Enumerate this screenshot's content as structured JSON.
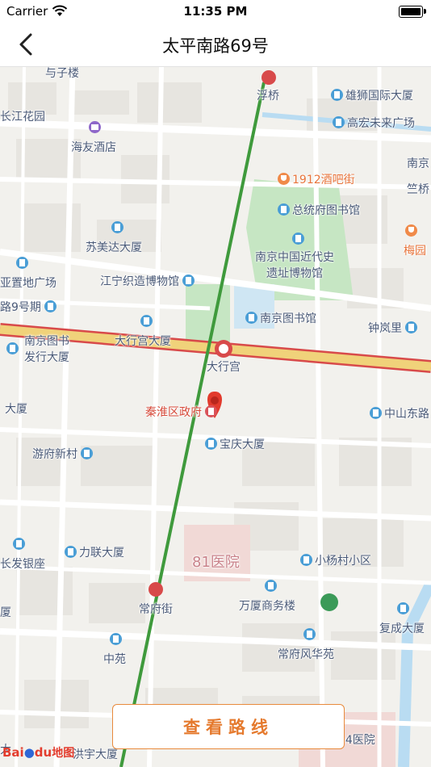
{
  "status": {
    "carrier": "Carrier",
    "time": "11:35 PM"
  },
  "nav": {
    "title": "太平南路69号"
  },
  "map": {
    "labels": {
      "yuzilou": "与子楼",
      "fuqiao": "浮桥",
      "xiongshi": "雄狮国际大厦",
      "changjiang": "长江花园",
      "gaohong": "高宏未来广场",
      "haiyou": "海友酒店",
      "nanjing_edge": "南京",
      "bar1912": "1912酒吧街",
      "zhuyuan": "竺桥",
      "zongtongfu": "总统府图书馆",
      "sumeida": "苏美达大厦",
      "museum_line1": "南京中国近代史",
      "museum_line2": "遗址博物馆",
      "meiyuan": "梅园",
      "yazhidi": "亚置地广场",
      "jiangning": "江宁织造博物馆",
      "lu9hao": "路9号期",
      "library": "南京图书馆",
      "zhonglanli": "钟岚里",
      "nanjingtushu1": "南京图书",
      "nanjingtushu2": "发行大厦",
      "daxinggong_tower": "大行宫大厦",
      "daxinggong_station": "大行宫",
      "qinhuai": "秦淮区政府",
      "zhongshan_east": "中山东路",
      "dasha_left": "大厦",
      "baoqing": "宝庆大厦",
      "youfu": "游府新村",
      "hospital81": "81医院",
      "changfa": "长发银座",
      "lilian": "力联大厦",
      "xiaoyang": "小杨村小区",
      "changfu_station": "常府街",
      "wanxia": "万厦商务楼",
      "xia_left": "厦",
      "fucheng": "复成大厦",
      "changfu_fenghua": "常府风华苑",
      "zhongyuan": "中苑",
      "hospital454": "454医院",
      "hongyu": "洪宇大厦",
      "da_left": "大"
    },
    "colors": {
      "metro_line": "#3f9a3c",
      "main_road": "#e5c268",
      "main_road_edge": "#d84a4a",
      "park": "#c6e6c3",
      "water": "#b9dcf2",
      "marker": "#e23a2c"
    }
  },
  "actions": {
    "view_route": "查看路线"
  },
  "logo": {
    "brand_a": "Bai",
    "brand_b": "du",
    "brand_c": "地图"
  }
}
